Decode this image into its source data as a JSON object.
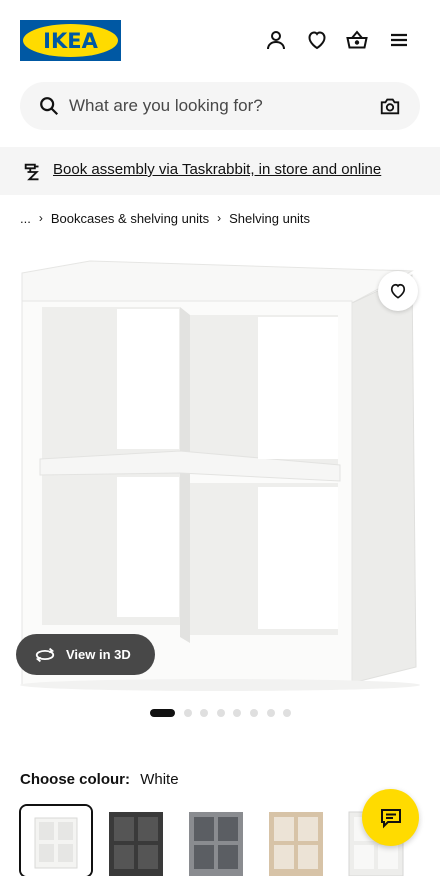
{
  "header": {
    "logo_text": "IKEA",
    "brand_colors": {
      "blue": "#0058a3",
      "yellow": "#ffdb00"
    },
    "icons": [
      "profile-icon",
      "heart-icon",
      "basket-icon",
      "menu-icon"
    ]
  },
  "search": {
    "placeholder": "What are you looking for?",
    "icons": [
      "search-icon",
      "camera-icon"
    ]
  },
  "banner": {
    "text": "Book assembly via Taskrabbit, in store and online",
    "icon": "tools-icon"
  },
  "breadcrumb": {
    "ellipsis": "...",
    "items": [
      "Bookcases & shelving units",
      "Shelving units"
    ]
  },
  "gallery": {
    "view3d_label": "View in 3D",
    "image_count": 9,
    "active_index": 0
  },
  "colour": {
    "label": "Choose colour:",
    "value": "White",
    "swatches": [
      {
        "name": "White",
        "color": "#f4f4f2",
        "selected": true
      },
      {
        "name": "Black-brown",
        "color": "#3a3a3a",
        "selected": false
      },
      {
        "name": "Grey",
        "color": "#5b5e63",
        "selected": false
      },
      {
        "name": "White stained oak effect",
        "color": "#cdb79c",
        "selected": false
      },
      {
        "name": "White",
        "color": "#ededeb",
        "selected": false
      }
    ]
  },
  "chat": {
    "icon": "chat-icon",
    "color": "#ffdb00"
  }
}
